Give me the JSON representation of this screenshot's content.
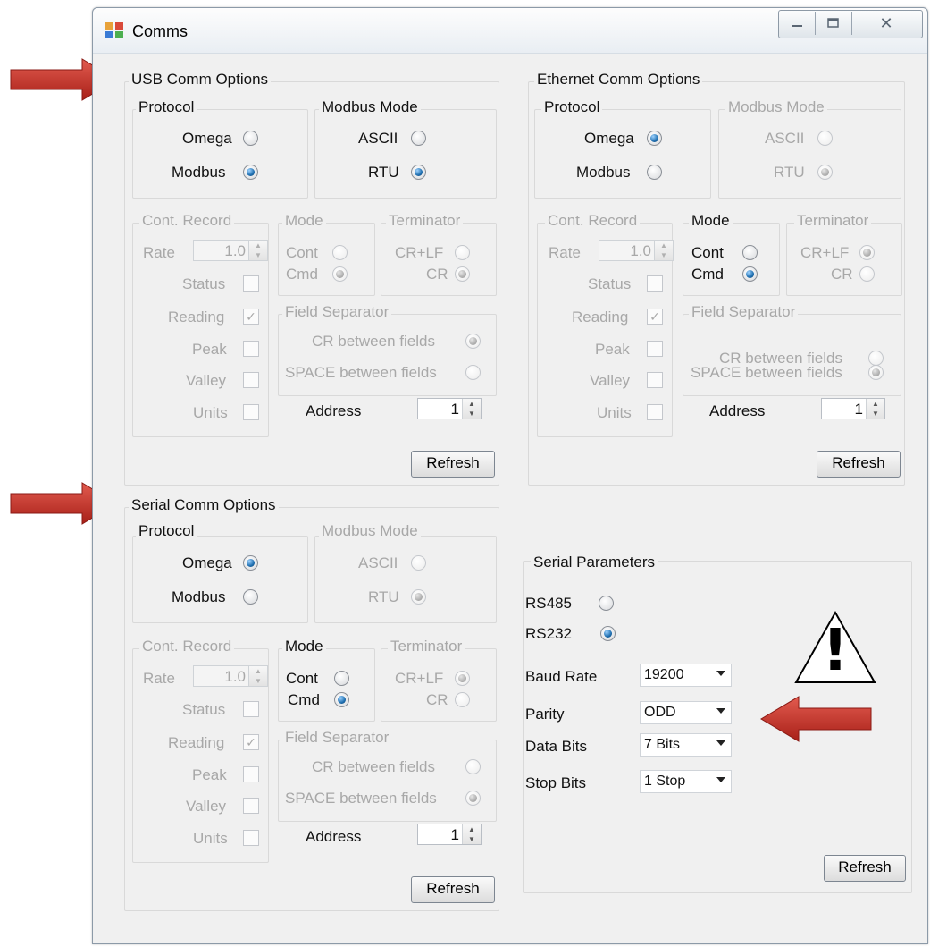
{
  "window": {
    "title": "Comms",
    "controls": {
      "minimize_icon": "minimize-icon",
      "maximize_icon": "maximize-icon",
      "close_icon": "close-icon",
      "close_glyph": "✕"
    }
  },
  "usb": {
    "title": "USB Comm Options",
    "protocol": {
      "title": "Protocol",
      "omega": "Omega",
      "modbus": "Modbus"
    },
    "modbus_mode": {
      "title": "Modbus Mode",
      "ascii": "ASCII",
      "rtu": "RTU"
    },
    "cont_record": {
      "title": "Cont. Record",
      "rate_label": "Rate",
      "rate_value": "1.0",
      "status": "Status",
      "reading": "Reading",
      "peak": "Peak",
      "valley": "Valley",
      "units": "Units"
    },
    "mode": {
      "title": "Mode",
      "cont": "Cont",
      "cmd": "Cmd"
    },
    "terminator": {
      "title": "Terminator",
      "crlf": "CR+LF",
      "cr": "CR"
    },
    "field_separator": {
      "title": "Field Separator",
      "cr_between": "CR between fields",
      "space_between": "SPACE between fields"
    },
    "address": {
      "label": "Address",
      "value": "1"
    },
    "refresh": "Refresh"
  },
  "ethernet": {
    "title": "Ethernet Comm Options",
    "protocol": {
      "title": "Protocol",
      "omega": "Omega",
      "modbus": "Modbus"
    },
    "modbus_mode": {
      "title": "Modbus Mode",
      "ascii": "ASCII",
      "rtu": "RTU"
    },
    "cont_record": {
      "title": "Cont. Record",
      "rate_label": "Rate",
      "rate_value": "1.0",
      "status": "Status",
      "reading": "Reading",
      "peak": "Peak",
      "valley": "Valley",
      "units": "Units"
    },
    "mode": {
      "title": "Mode",
      "cont": "Cont",
      "cmd": "Cmd"
    },
    "terminator": {
      "title": "Terminator",
      "crlf": "CR+LF",
      "cr": "CR"
    },
    "field_separator": {
      "title": "Field Separator",
      "cr_between": "CR between fields",
      "space_between": "SPACE between fields"
    },
    "address": {
      "label": "Address",
      "value": "1"
    },
    "refresh": "Refresh"
  },
  "serial": {
    "title": "Serial Comm Options",
    "protocol": {
      "title": "Protocol",
      "omega": "Omega",
      "modbus": "Modbus"
    },
    "modbus_mode": {
      "title": "Modbus Mode",
      "ascii": "ASCII",
      "rtu": "RTU"
    },
    "cont_record": {
      "title": "Cont. Record",
      "rate_label": "Rate",
      "rate_value": "1.0",
      "status": "Status",
      "reading": "Reading",
      "peak": "Peak",
      "valley": "Valley",
      "units": "Units"
    },
    "mode": {
      "title": "Mode",
      "cont": "Cont",
      "cmd": "Cmd"
    },
    "terminator": {
      "title": "Terminator",
      "crlf": "CR+LF",
      "cr": "CR"
    },
    "field_separator": {
      "title": "Field Separator",
      "cr_between": "CR between fields",
      "space_between": "SPACE between fields"
    },
    "address": {
      "label": "Address",
      "value": "1"
    },
    "refresh": "Refresh"
  },
  "serial_params": {
    "title": "Serial Parameters",
    "rs485": "RS485",
    "rs232": "RS232",
    "baud_rate": {
      "label": "Baud Rate",
      "value": "19200"
    },
    "parity": {
      "label": "Parity",
      "value": "ODD"
    },
    "data_bits": {
      "label": "Data Bits",
      "value": "7 Bits"
    },
    "stop_bits": {
      "label": "Stop Bits",
      "value": "1 Stop"
    },
    "refresh": "Refresh"
  },
  "annotations": {
    "warning_glyph": "!",
    "arrow_color": "#c8302a",
    "warning_icon": "warning-triangle-icon",
    "arrow_icon": "red-arrow-icon"
  },
  "glyphs": {
    "checkmark": "✓",
    "spin_up": "▲",
    "spin_down": "▼"
  }
}
